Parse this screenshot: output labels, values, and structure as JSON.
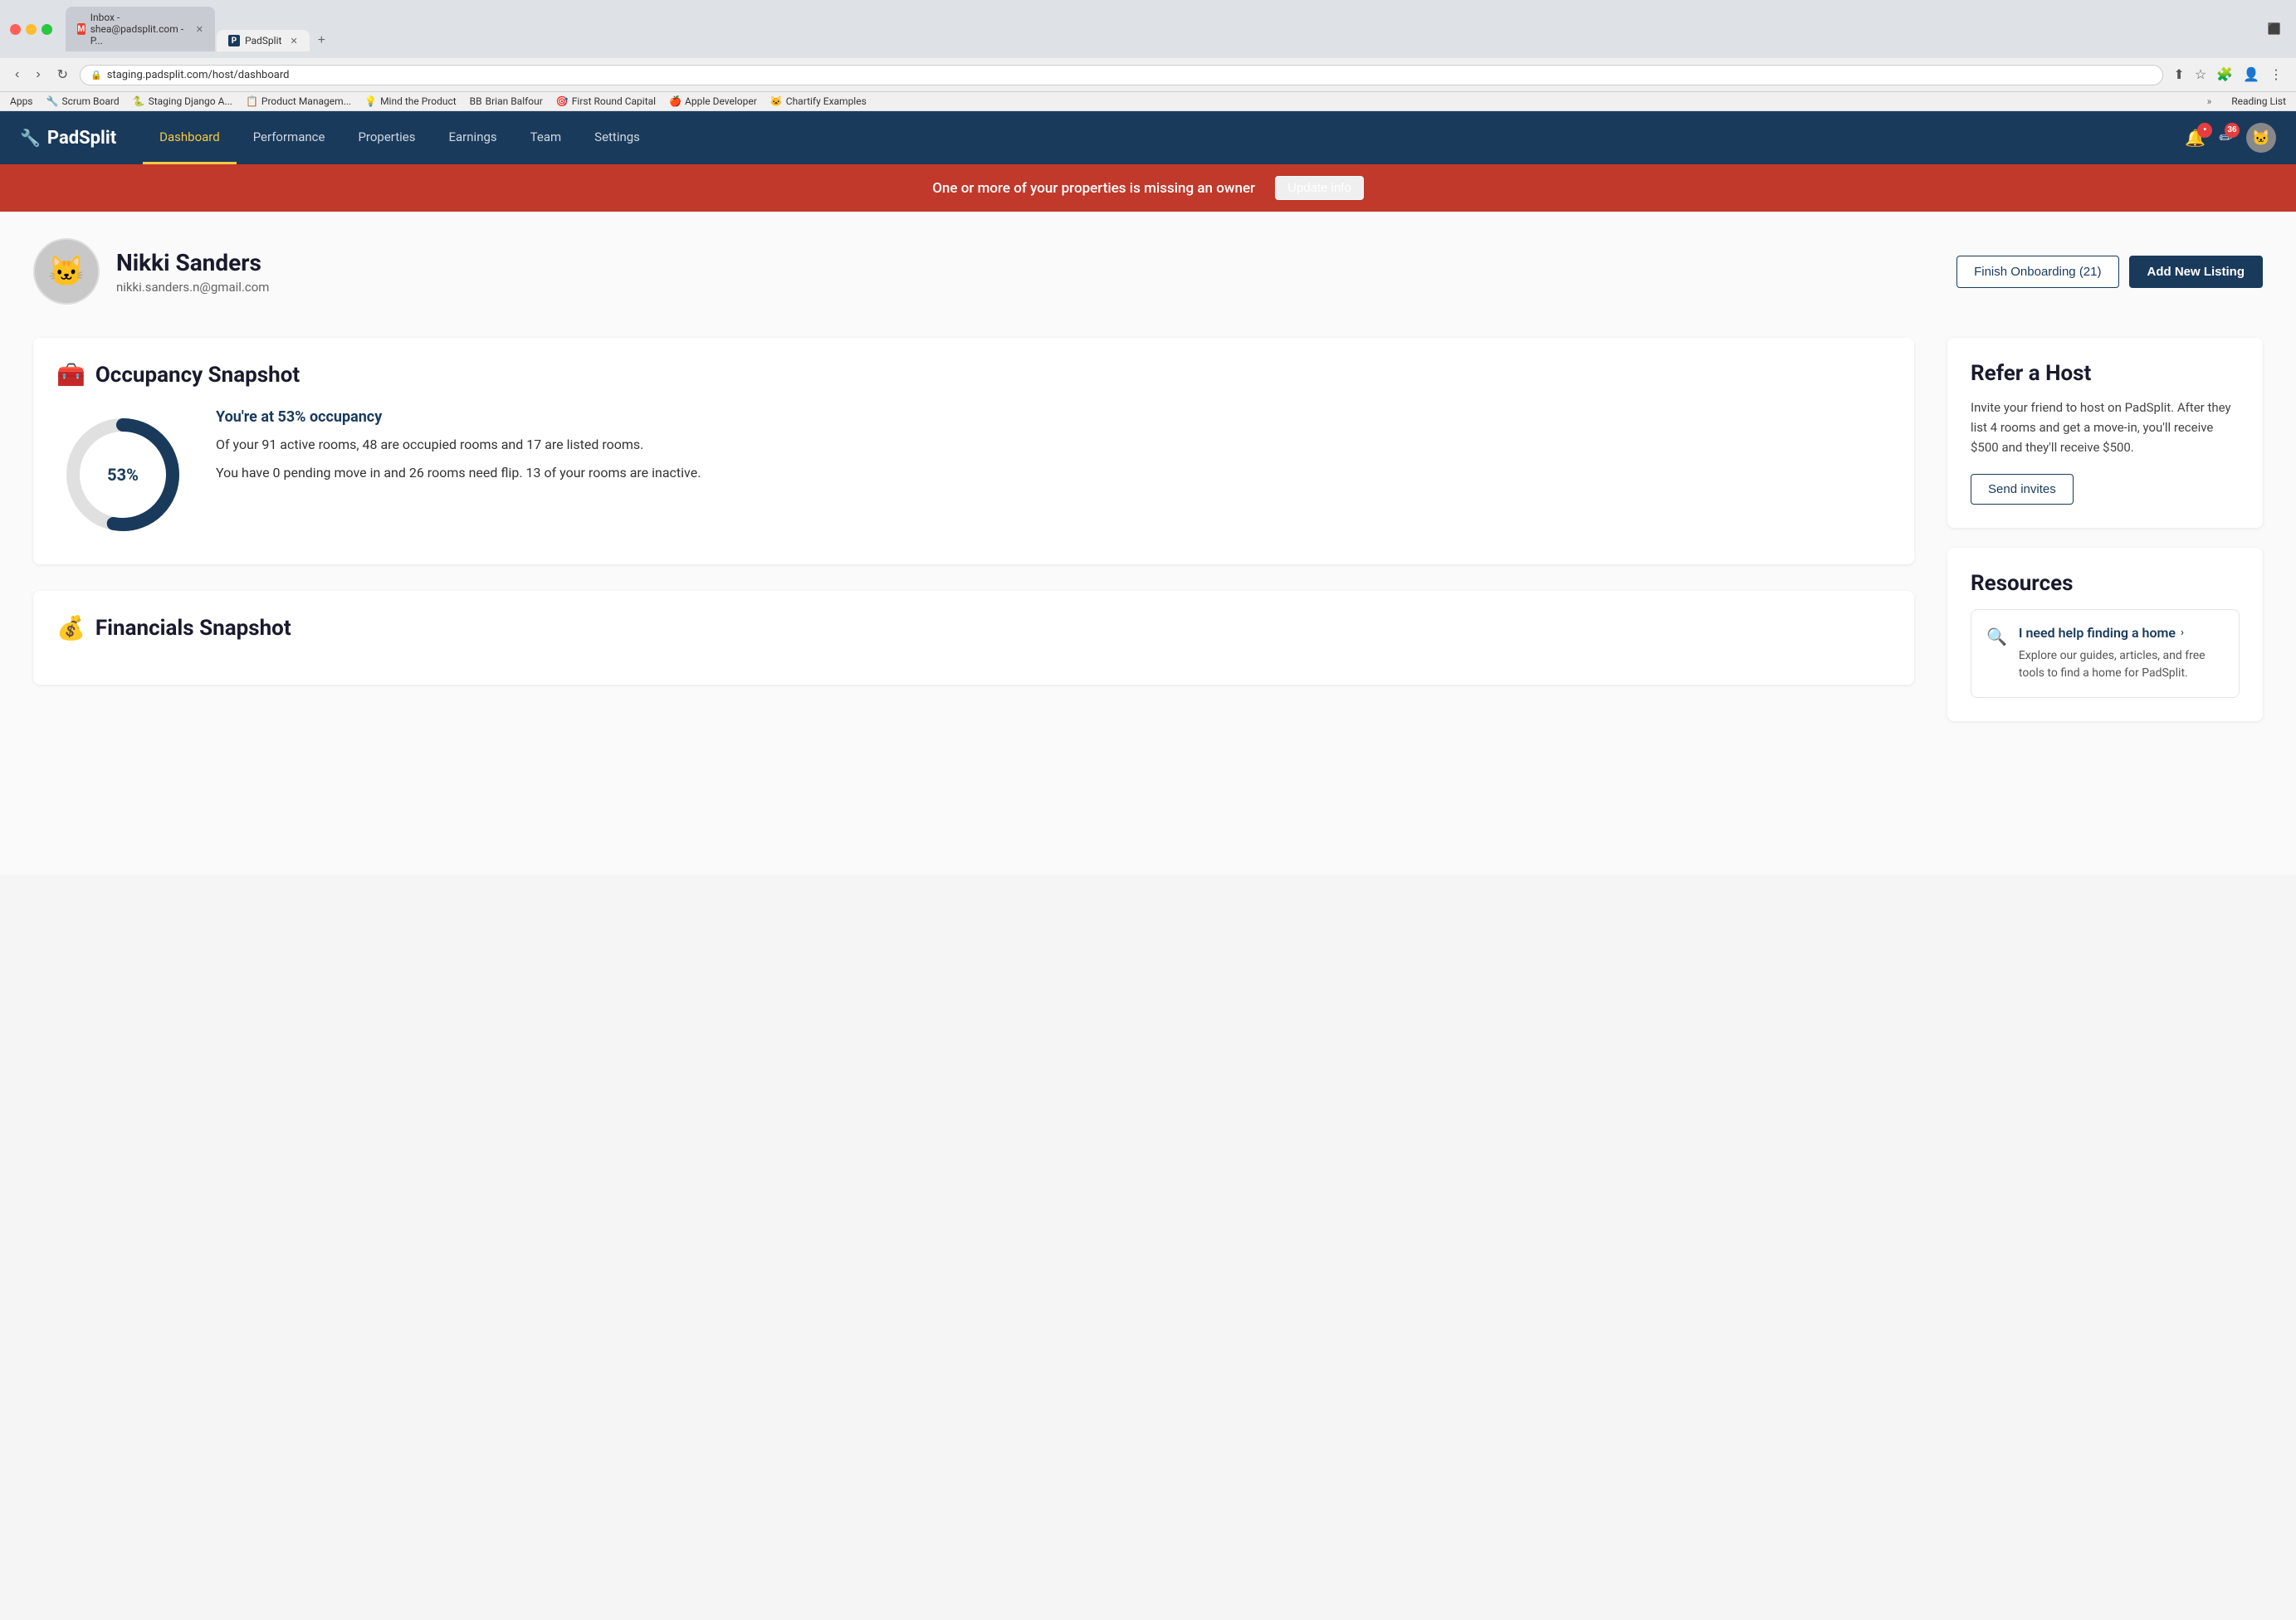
{
  "browser": {
    "tabs": [
      {
        "id": "gmail",
        "label": "Inbox - shea@padsplit.com - P...",
        "favicon": "M",
        "active": false
      },
      {
        "id": "padsplit",
        "label": "PadSplit",
        "favicon": "P",
        "active": true
      }
    ],
    "address": "staging.padsplit.com/host/dashboard",
    "bookmarks": [
      {
        "id": "apps",
        "label": "Apps"
      },
      {
        "id": "scrum",
        "label": "Scrum Board"
      },
      {
        "id": "django",
        "label": "Staging Django A..."
      },
      {
        "id": "product",
        "label": "Product Managem..."
      },
      {
        "id": "mind",
        "label": "Mind the Product"
      },
      {
        "id": "brian",
        "label": "Brian Balfour"
      },
      {
        "id": "firstround",
        "label": "First Round Capital"
      },
      {
        "id": "apple",
        "label": "Apple Developer"
      },
      {
        "id": "chartify",
        "label": "Chartify Examples"
      }
    ],
    "bookmarks_more": "»",
    "reading_list": "Reading List"
  },
  "nav": {
    "logo_icon": "🔧",
    "logo_text": "PadSplit",
    "links": [
      {
        "id": "dashboard",
        "label": "Dashboard",
        "active": true
      },
      {
        "id": "performance",
        "label": "Performance",
        "active": false
      },
      {
        "id": "properties",
        "label": "Properties",
        "active": false
      },
      {
        "id": "earnings",
        "label": "Earnings",
        "active": false
      },
      {
        "id": "team",
        "label": "Team",
        "active": false
      },
      {
        "id": "settings",
        "label": "Settings",
        "active": false
      }
    ],
    "notification_badge": "",
    "pencil_badge": "36",
    "avatar_emoji": "🐱"
  },
  "alert": {
    "text": "One or more of your properties is missing an owner",
    "link_label": "Update info"
  },
  "profile": {
    "name": "Nikki Sanders",
    "email": "nikki.sanders.n@gmail.com",
    "avatar_emoji": "🐱",
    "finish_onboarding_label": "Finish Onboarding (21)",
    "add_listing_label": "Add New Listing"
  },
  "occupancy": {
    "icon": "🧰",
    "title": "Occupancy Snapshot",
    "percent": 53,
    "headline": "You're at 53% occupancy",
    "detail_1": "Of your 91 active rooms, 48 are occupied rooms and 17 are listed rooms.",
    "detail_2": "You have 0 pending move in and 26 rooms need flip. 13 of your rooms are inactive.",
    "donut_bg": "#e0e0e0",
    "donut_fg": "#1a3a5c"
  },
  "financials": {
    "icon": "💰",
    "title": "Financials Snapshot"
  },
  "refer": {
    "title": "Refer a Host",
    "text": "Invite your friend to host on PadSplit. After they list 4 rooms and get a move-in, you'll receive $500 and they'll receive $500.",
    "send_invites_label": "Send invites"
  },
  "resources": {
    "title": "Resources",
    "item": {
      "link_label": "I need help finding a home",
      "description": "Explore our guides, articles, and free tools to find a home for PadSplit."
    }
  }
}
